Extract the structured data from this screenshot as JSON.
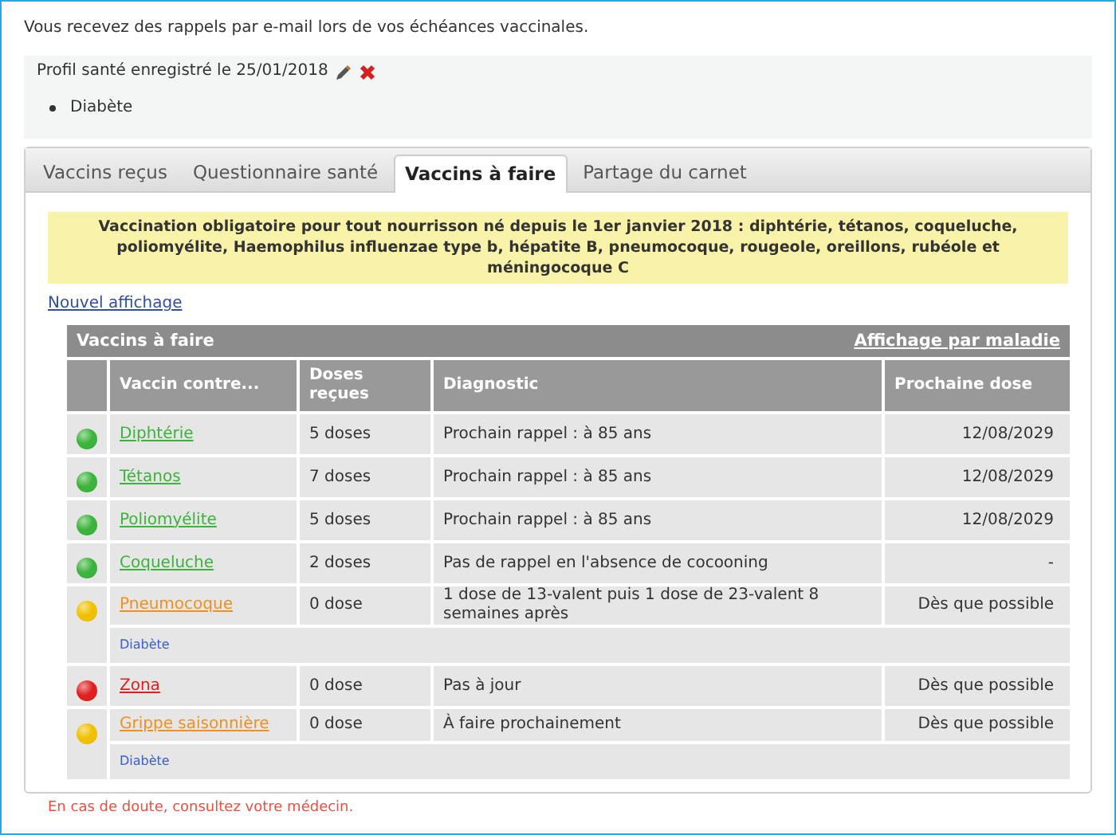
{
  "intro": "Vous recevez des rappels par e-mail lors de vos échéances vaccinales.",
  "profile": {
    "label": "Profil santé enregistré le 25/01/2018",
    "conditions": [
      "Diabète"
    ]
  },
  "tabs": [
    {
      "label": "Vaccins reçus",
      "selected": false
    },
    {
      "label": "Questionnaire santé",
      "selected": false
    },
    {
      "label": "Vaccins à faire",
      "selected": true
    },
    {
      "label": "Partage du carnet",
      "selected": false
    }
  ],
  "notice": "Vaccination obligatoire pour tout nourrisson né depuis le 1er janvier 2018 : diphtérie, tétanos, coqueluche, poliomyélite, Haemophilus influenzae type b, hépatite B, pneumocoque, rougeole, oreillons, rubéole et méningocoque C",
  "view_link": "Nouvel affichage",
  "table": {
    "title": "Vaccins à faire",
    "view_by_disease": "Affichage par maladie",
    "columns": [
      "Vaccin contre...",
      "Doses reçues",
      "Diagnostic",
      "Prochaine dose"
    ],
    "rows": [
      {
        "color": "#3cb43c",
        "vaccine": "Diphtérie",
        "doses": "5 doses",
        "diagnostic": "Prochain rappel : à 85 ans",
        "next": "12/08/2029"
      },
      {
        "color": "#3cb43c",
        "vaccine": "Tétanos",
        "doses": "7 doses",
        "diagnostic": "Prochain rappel : à 85 ans",
        "next": "12/08/2029"
      },
      {
        "color": "#3cb43c",
        "vaccine": "Poliomyélite",
        "doses": "5 doses",
        "diagnostic": "Prochain rappel : à 85 ans",
        "next": "12/08/2029"
      },
      {
        "color": "#3cb43c",
        "vaccine": "Coqueluche",
        "doses": "2 doses",
        "diagnostic": "Pas de rappel en l'absence de cocooning",
        "next": "-"
      },
      {
        "color": "#f0c000",
        "vaccine": "Pneumocoque",
        "doses": "0 dose",
        "diagnostic": "1 dose de 13-valent puis 1 dose de 23-valent 8 semaines après",
        "next": "Dès que possible",
        "note": "Diabète"
      },
      {
        "color": "#e02020",
        "vaccine": "Zona",
        "doses": "0 dose",
        "diagnostic": "Pas à jour",
        "next": "Dès que possible"
      },
      {
        "color": "#f0c000",
        "vaccine": "Grippe saisonnière",
        "doses": "0 dose",
        "diagnostic": "À faire prochainement",
        "next": "Dès que possible",
        "note": "Diabète"
      }
    ]
  },
  "footer": "En cas de doute, consultez votre médecin."
}
